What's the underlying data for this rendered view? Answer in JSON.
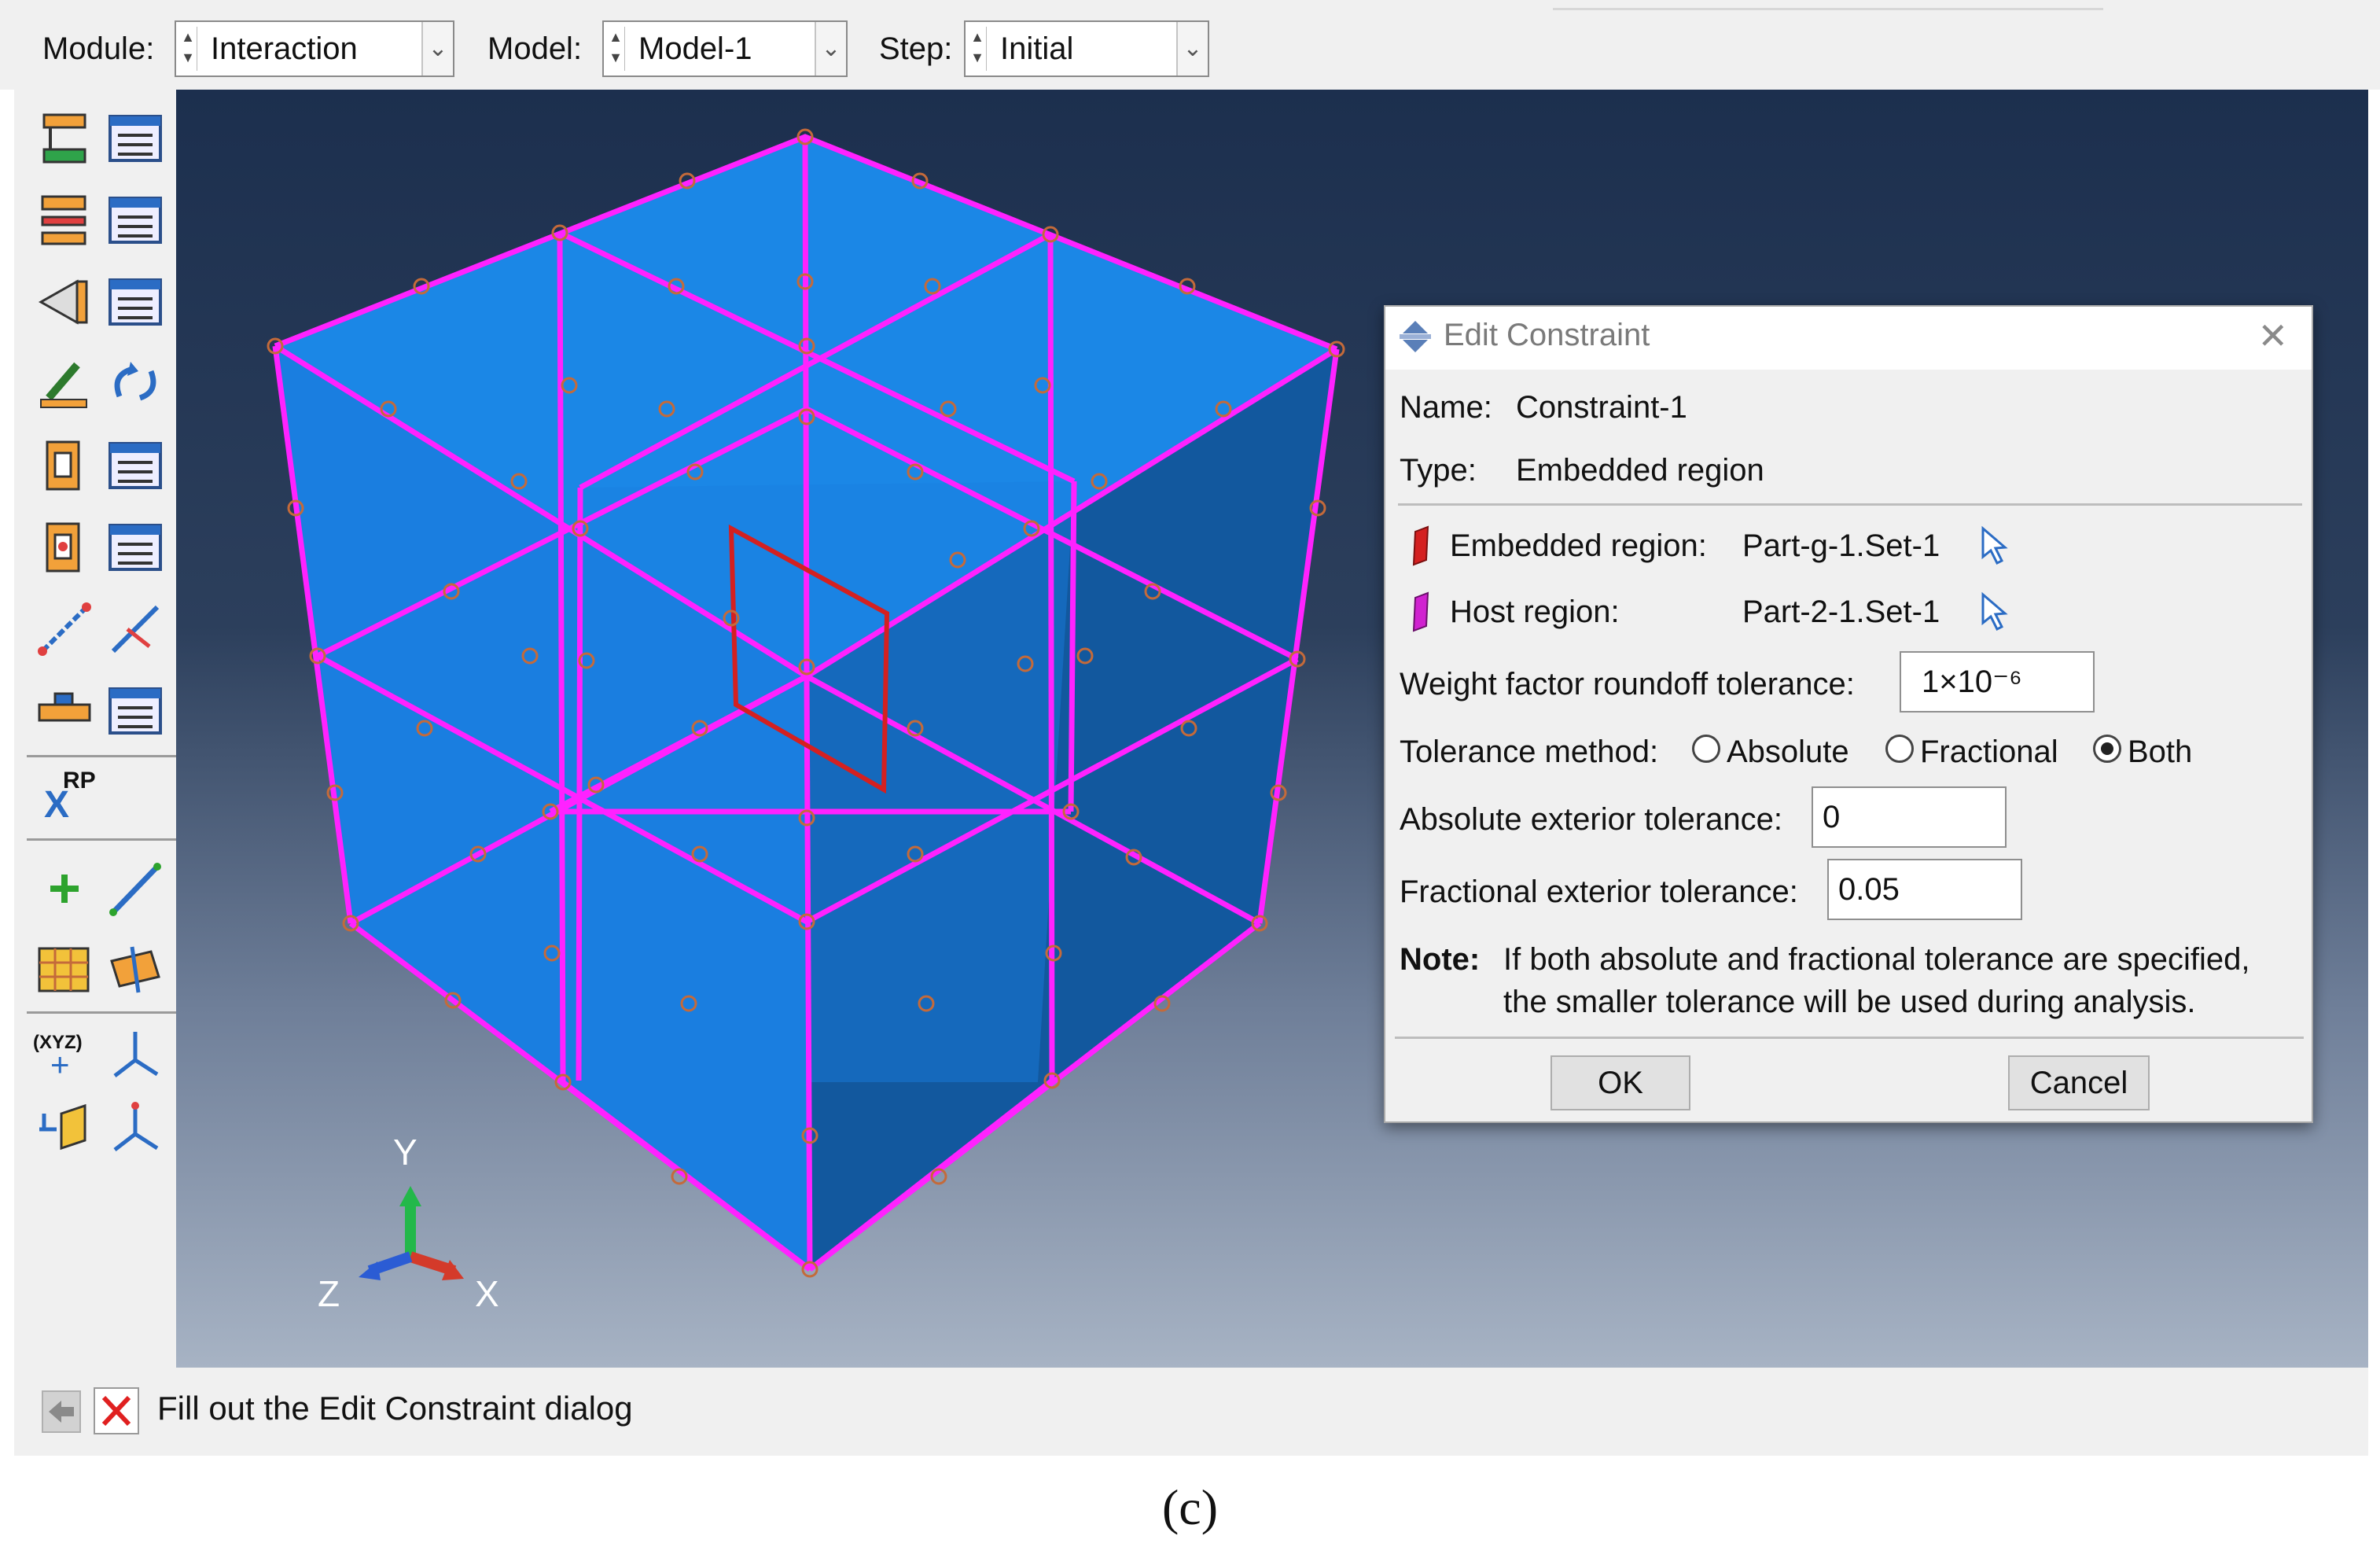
{
  "topbar": {
    "module": {
      "label": "Module:",
      "value": "Interaction"
    },
    "model": {
      "label": "Model:",
      "value": "Model-1"
    },
    "step": {
      "label": "Step:",
      "value": "Initial"
    }
  },
  "toolbox": {
    "tools": [
      "create-interaction-icon",
      "interaction-manager-icon",
      "create-interaction-property-icon",
      "interaction-property-manager-icon",
      "create-contact-control-icon",
      "contact-control-manager-icon",
      "create-contact-initialization-icon",
      "contact-stabilization-icon",
      "create-constraint-icon",
      "constraint-manager-icon",
      "create-connector-section-icon",
      "connector-section-manager-icon",
      "create-wire-icon",
      "create-connector-assignment-icon",
      "create-inertia-icon",
      "inertia-manager-icon",
      "reference-point-icon",
      "create-datum-point-icon",
      "create-datum-axis-icon",
      "create-mesh-icon",
      "create-partition-icon",
      "datum-point-xyz-icon",
      "datum-csys-icon",
      "datum-plane-icon",
      "datum-csys-offset-icon"
    ],
    "rp_label": "RP",
    "rp_axis": "X",
    "xyz_label": "(XYZ)"
  },
  "viewport": {
    "triad": {
      "y": "Y",
      "z": "Z",
      "x": "X"
    },
    "colors": {
      "face_light": "#1b87e6",
      "face_dark": "#12589e",
      "edge": "#ff22ff",
      "node": "#c46a3a",
      "embedded": "#d42020"
    }
  },
  "dialog": {
    "title": "Edit Constraint",
    "name_label": "Name:",
    "name_value": "Constraint-1",
    "type_label": "Type:",
    "type_value": "Embedded region",
    "embedded_label": "Embedded region:",
    "embedded_value": "Part-g-1.Set-1",
    "host_label": "Host region:",
    "host_value": "Part-2-1.Set-1",
    "weight_label": "Weight factor roundoff tolerance:",
    "weight_value": "1×10⁻⁶",
    "tolerance_label": "Tolerance method:",
    "tolerance_options": [
      "Absolute",
      "Fractional",
      "Both"
    ],
    "tolerance_selected": "Both",
    "abs_label": "Absolute exterior tolerance:",
    "abs_value": "0",
    "frac_label": "Fractional exterior tolerance:",
    "frac_value": "0.05",
    "note_label": "Note:",
    "note_line1": "If both absolute and fractional tolerance are specified,",
    "note_line2": "the smaller tolerance will be used during analysis.",
    "ok": "OK",
    "cancel": "Cancel"
  },
  "prompt": {
    "text": "Fill out the Edit Constraint dialog"
  },
  "caption": "(c)"
}
